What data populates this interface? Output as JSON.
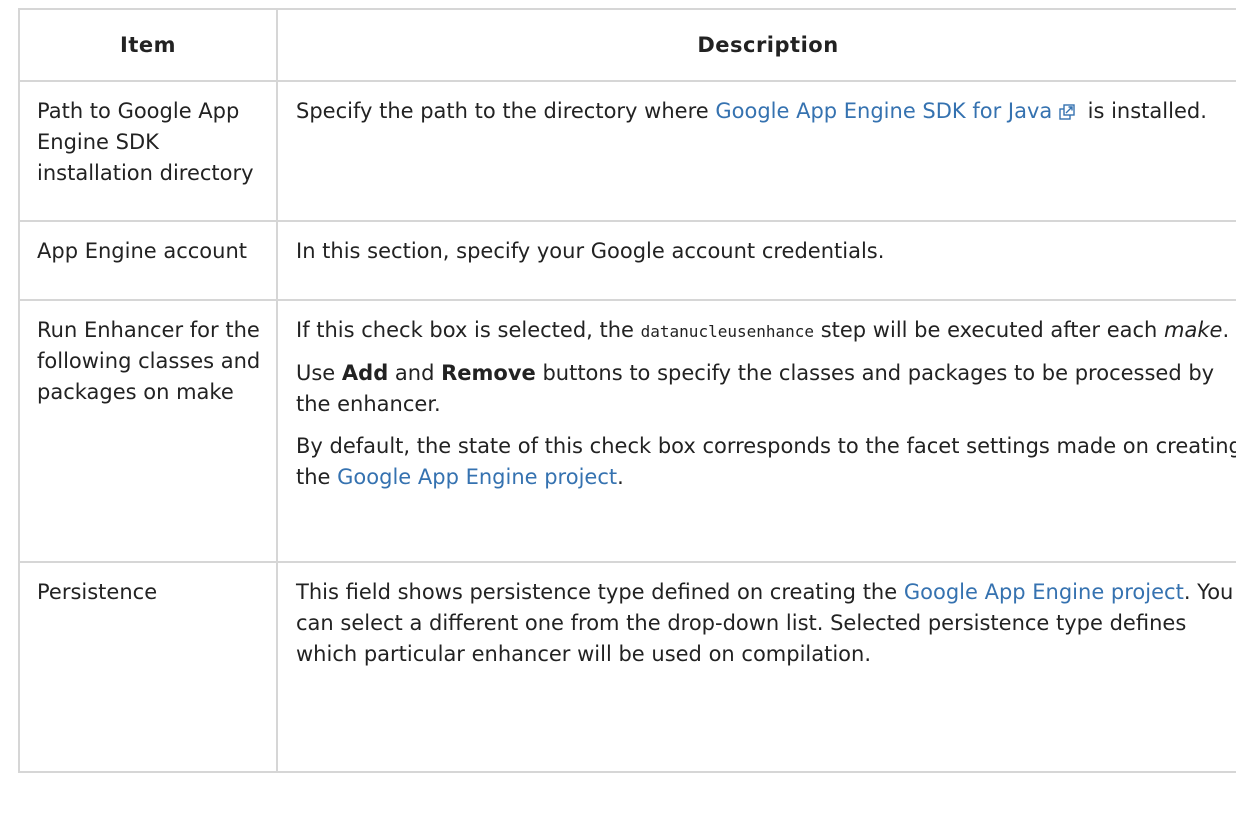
{
  "header": {
    "item": "Item",
    "description": "Description"
  },
  "rows": [
    {
      "item": "Path to Google App Engine SDK installation directory",
      "desc": {
        "pre": "Specify the path to the directory where ",
        "link": "Google App Engine SDK for Java",
        "icon": "external-link-icon",
        "post": " is installed."
      }
    },
    {
      "item": "App Engine account",
      "desc": {
        "text": "In this section, specify your Google account credentials."
      }
    },
    {
      "item": "Run Enhancer for the following classes and packages on make",
      "desc": {
        "p1_pre": "If this check box is selected, the ",
        "p1_code": "datanucleusenhance",
        "p1_mid": " step will be executed after each ",
        "p1_em": "make",
        "p1_end": ".",
        "p2_pre": "Use ",
        "p2_b1": "Add",
        "p2_mid": " and ",
        "p2_b2": "Remove",
        "p2_post": " buttons to specify the classes and packages to be processed by the enhancer.",
        "p3_pre": "By default, the state of this check box corresponds to the facet settings made on creating the ",
        "p3_link": "Google App Engine project",
        "p3_end": "."
      }
    },
    {
      "item": "Persistence",
      "desc": {
        "pre": "This field shows persistence type defined on creating the ",
        "link": "Google App Engine project",
        "post": ". You can select a different one from the drop-down list. Selected persistence type defines which particular enhancer will be used on compilation."
      }
    }
  ],
  "colors": {
    "link": "#3572b0",
    "border": "#d6d6d6",
    "text": "#222222"
  }
}
